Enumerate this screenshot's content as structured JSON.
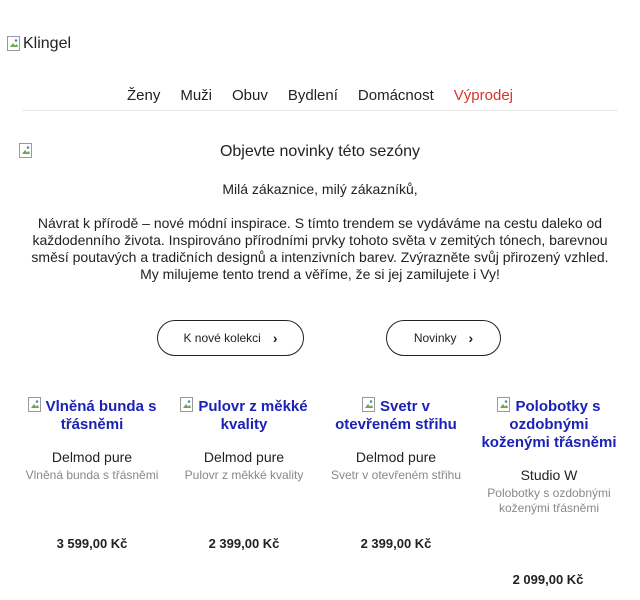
{
  "header": {
    "logo_alt": "Klingel"
  },
  "nav": {
    "items": [
      "Ženy",
      "Muži",
      "Obuv",
      "Bydlení",
      "Domácnost"
    ],
    "sale": "Výprodej",
    "sale_color": "#d9342b"
  },
  "hero": {
    "title": "Objevte novinky této sezóny",
    "greeting": "Milá zákaznice, milý zákazníků,",
    "intro": "Návrat k přírodě – nové módní inspirace. S tímto trendem se vydáváme na cestu daleko od každodenního života. Inspirováno přírodními prvky tohoto světa v zemitých tónech, barevnou směsí poutavých a tradičních designů a intenzivních barev. Zvýrazněte svůj přirozený vzhled. My milujeme tento trend a věříme, že si jej zamilujete i Vy!"
  },
  "buttons": {
    "collection": "K nové kolekci",
    "new": "Novinky",
    "chevron": "›"
  },
  "products": [
    {
      "title": "Vlněná bunda s třásněmi",
      "brand": "Delmod pure",
      "subtitle": "Vlněná bunda s třásněmi",
      "price": "3 599,00 Kč"
    },
    {
      "title": "Pulovr z měkké kvality",
      "brand": "Delmod pure",
      "subtitle": "Pulovr z měkké kvality",
      "price": "2 399,00 Kč"
    },
    {
      "title": "Svetr v otevřeném střihu",
      "brand": "Delmod pure",
      "subtitle": "Svetr v otevřeném střihu",
      "price": "2 399,00 Kč"
    },
    {
      "title": "Polobotky s ozdobnými koženými třásněmi",
      "brand": "Studio W",
      "subtitle": "Polobotky s ozdobnými koženými třásněmi",
      "price": "2 099,00 Kč"
    }
  ],
  "colors": {
    "link": "#1a23b5",
    "muted": "#888888",
    "text": "#222222"
  }
}
